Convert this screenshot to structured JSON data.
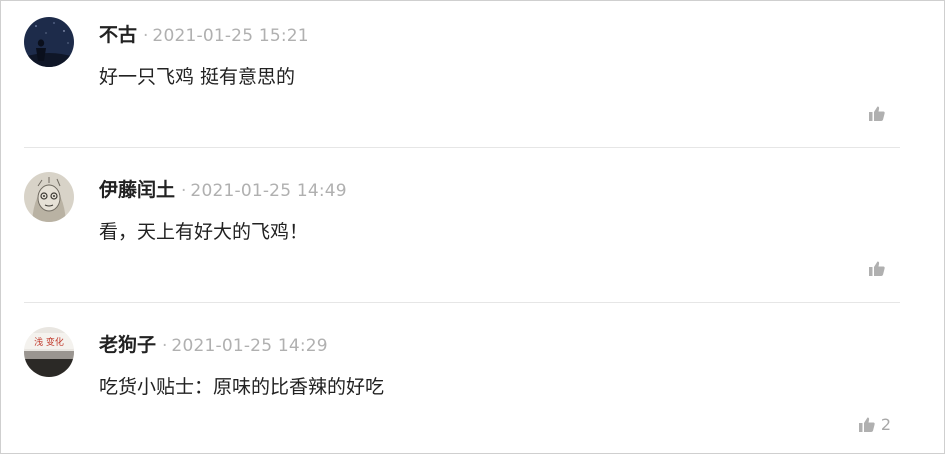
{
  "comments": [
    {
      "author": "不古",
      "separator": "·",
      "time": "2021-01-25 15:21",
      "text": "好一只飞鸡 挺有意思的",
      "likes": ""
    },
    {
      "author": "伊藤闰土",
      "separator": "·",
      "time": "2021-01-25 14:49",
      "text": "看，天上有好大的飞鸡！",
      "likes": ""
    },
    {
      "author": "老狗子",
      "separator": "·",
      "time": "2021-01-25 14:29",
      "text": "吃货小贴士：原味的比香辣的好吃",
      "likes": "2",
      "avatar_sign_text": "浅 变化"
    }
  ],
  "icons": {
    "like": "thumbs-up-icon"
  },
  "colors": {
    "meta": "#b0b0b0",
    "text": "#222222",
    "divider": "#e6e6e6"
  }
}
